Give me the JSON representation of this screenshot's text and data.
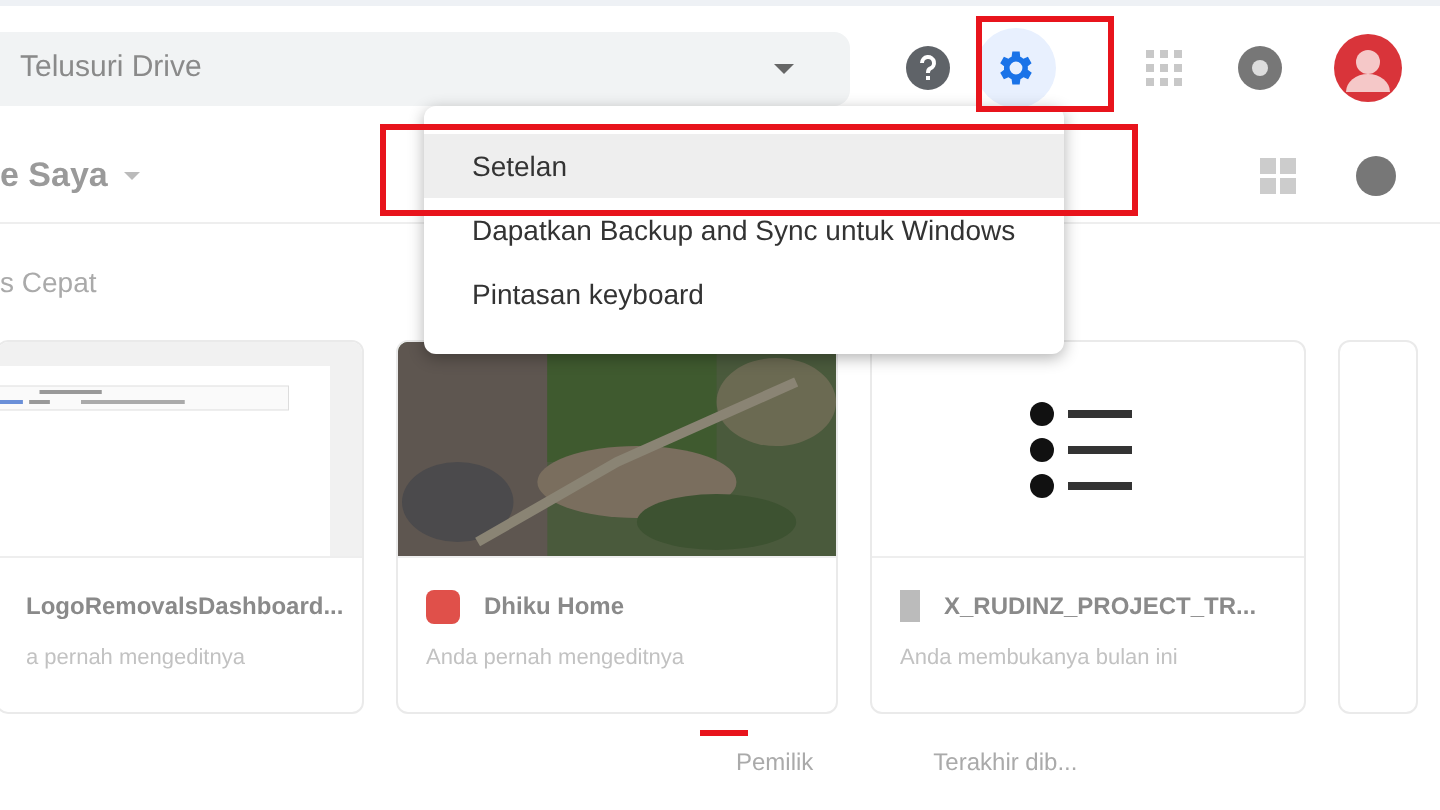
{
  "search": {
    "placeholder": "Telusuri Drive"
  },
  "breadcrumb": "e Saya",
  "section_title": "s Cepat",
  "menu": {
    "items": [
      {
        "label": "Setelan",
        "selected": true
      },
      {
        "label": "Dapatkan Backup and Sync untuk Windows",
        "selected": false
      },
      {
        "label": "Pintasan keyboard",
        "selected": false
      }
    ]
  },
  "cards": [
    {
      "kind": "document",
      "title": "LogoRemovalsDashboard...",
      "subtitle": "a pernah mengeditnya"
    },
    {
      "kind": "picture",
      "title": "Dhiku Home",
      "subtitle": "Anda pernah mengeditnya"
    },
    {
      "kind": "list",
      "title": "X_RUDINZ_PROJECT_TR...",
      "subtitle": "Anda membukanya bulan ini"
    }
  ],
  "columns": [
    "Pemilik",
    "Terakhir dib..."
  ]
}
